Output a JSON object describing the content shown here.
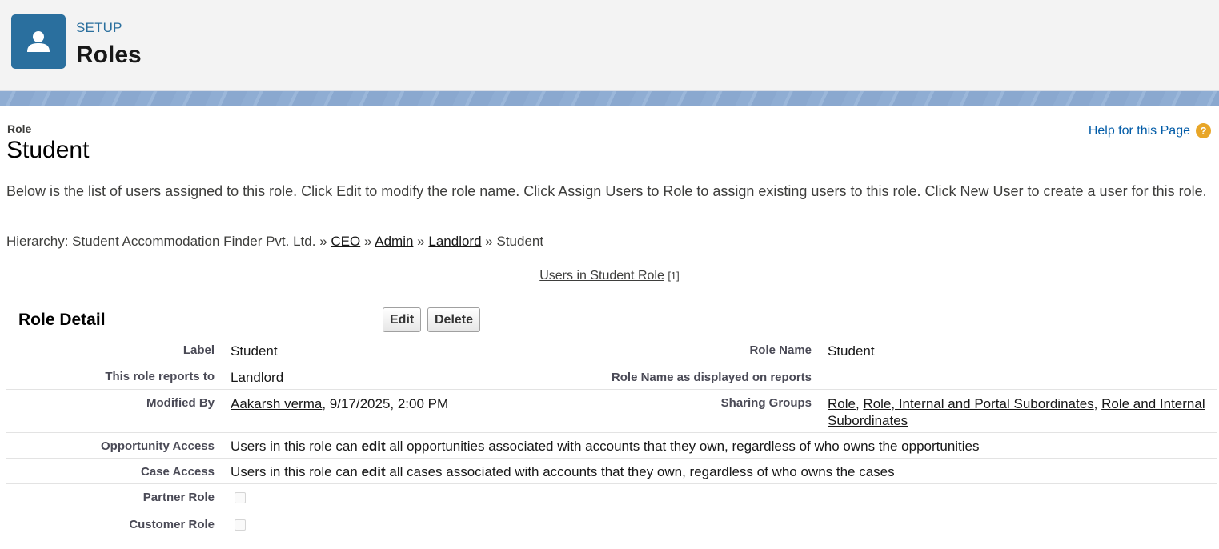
{
  "header": {
    "eyebrow": "SETUP",
    "title": "Roles",
    "icon": "user-icon",
    "icon_bg": "#2a6f9e"
  },
  "page": {
    "type_label": "Role",
    "title": "Student",
    "help_link": "Help for this Page",
    "help_icon": "?",
    "description": "Below is the list of users assigned to this role. Click Edit to modify the role name. Click Assign Users to Role to assign existing users to this role. Click New User to create a user for this role."
  },
  "hierarchy": {
    "prefix": "Hierarchy: Student Accommodation Finder Pvt. Ltd.",
    "separator": "»",
    "links": [
      "CEO",
      "Admin",
      "Landlord"
    ],
    "current": "Student"
  },
  "related": {
    "link_label": "Users in Student Role",
    "count": "[1]"
  },
  "detail": {
    "section_title": "Role Detail",
    "edit_label": "Edit",
    "delete_label": "Delete",
    "label_label": "Label",
    "label_value": "Student",
    "role_name_label": "Role Name",
    "role_name_value": "Student",
    "reports_to_label": "This role reports to",
    "reports_to_value": "Landlord",
    "display_name_label": "Role Name as displayed on reports",
    "display_name_value": "",
    "modified_by_label": "Modified By",
    "modified_by_user": "Aakarsh verma",
    "modified_by_date": ", 9/17/2025, 2:00 PM",
    "sharing_groups_label": "Sharing Groups",
    "sharing_groups": [
      "Role",
      "Role, Internal and Portal Subordinates",
      "Role and Internal Subordinates"
    ],
    "opportunity_access_label": "Opportunity Access",
    "opportunity_access_pre": "Users in this role can ",
    "opportunity_access_bold": "edit",
    "opportunity_access_post": " all opportunities associated with accounts that they own, regardless of who owns the opportunities",
    "case_access_label": "Case Access",
    "case_access_pre": "Users in this role can ",
    "case_access_bold": "edit",
    "case_access_post": " all cases associated with accounts that they own, regardless of who owns the cases",
    "partner_role_label": "Partner Role",
    "partner_role_checked": false,
    "customer_role_label": "Customer Role",
    "customer_role_checked": false
  }
}
